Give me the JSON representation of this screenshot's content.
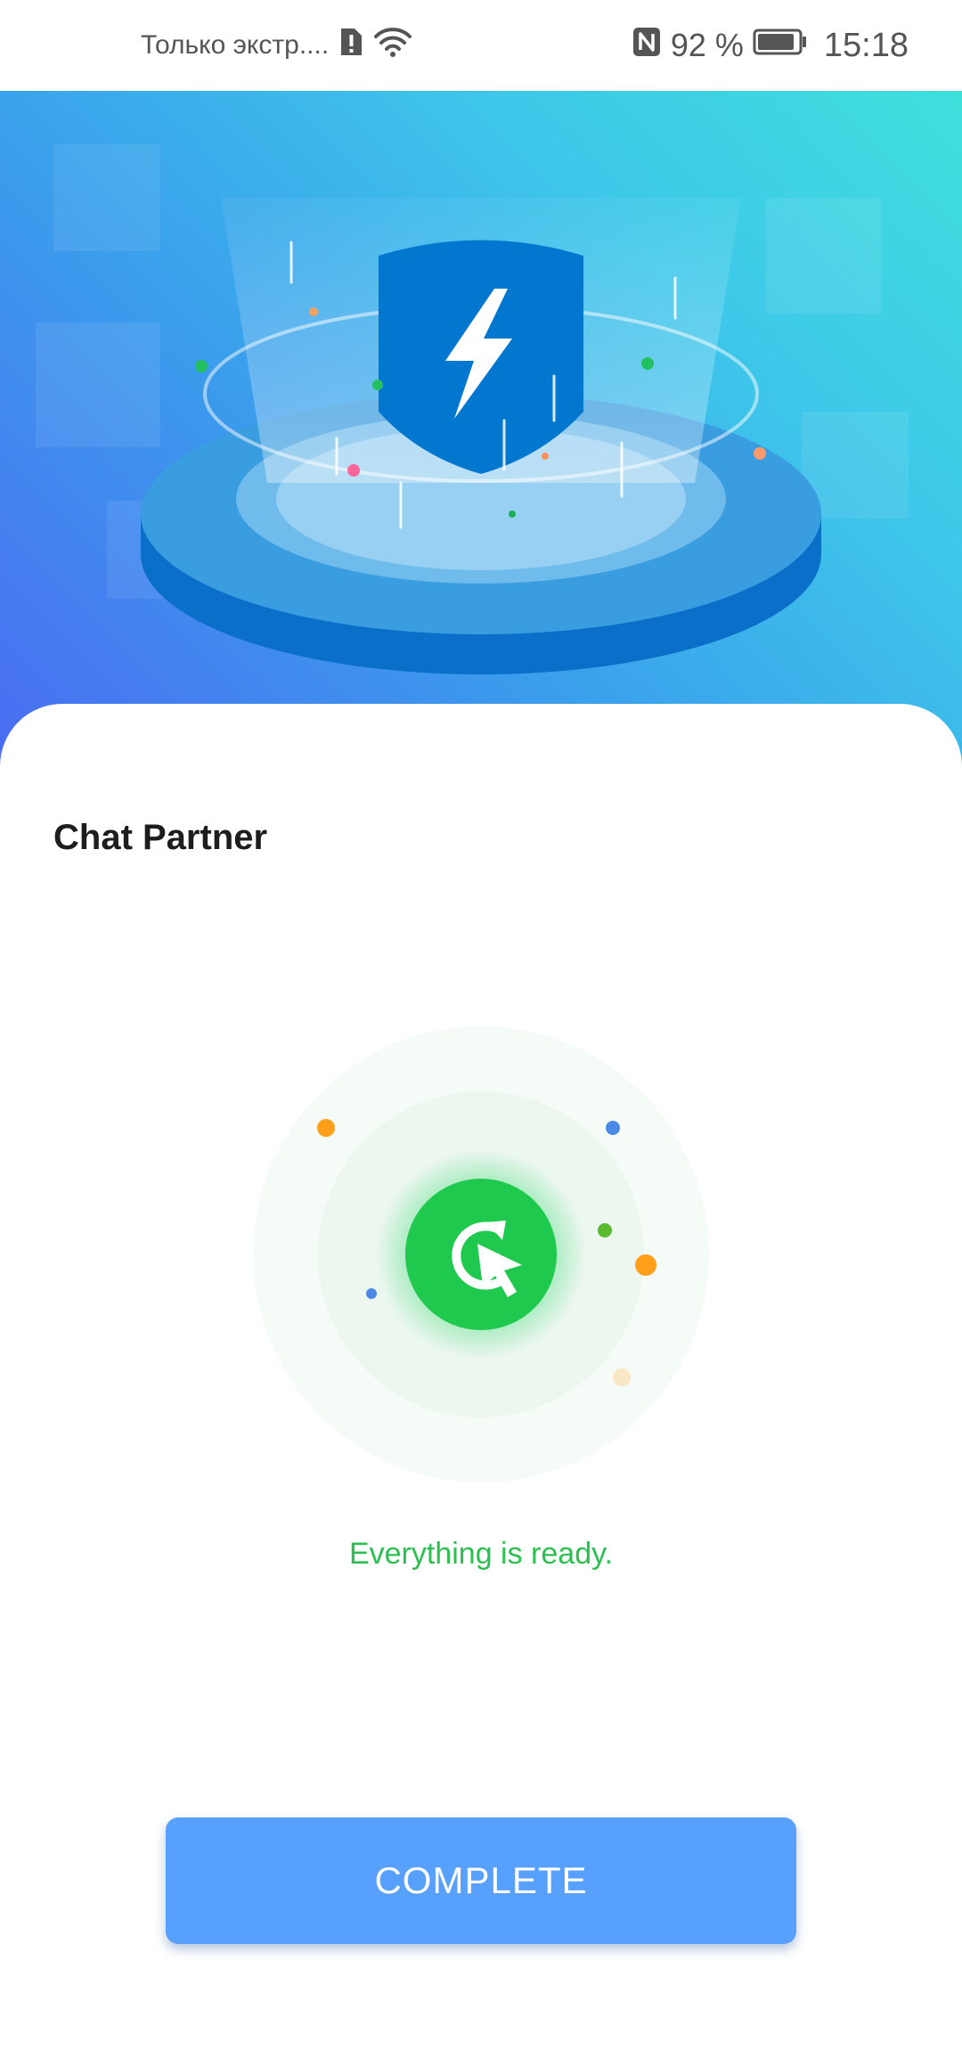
{
  "status_bar": {
    "network_label": "Только экстр....",
    "battery_percent": "92 %",
    "battery_level": 0.92,
    "time": "15:18",
    "icons": [
      "sim-alert-icon",
      "wifi-icon",
      "nfc-icon",
      "battery-icon"
    ]
  },
  "hero": {
    "icon": "shield-lightning-icon",
    "colors": {
      "gradient_start": "#4a6cf2",
      "gradient_end": "#3fe0dc",
      "shield": "#0277d0"
    }
  },
  "card": {
    "app_title": "Chat Partner",
    "status_icon": "refresh-cursor-icon",
    "status_text": "Everything is ready.",
    "complete_button_label": "COMPLETE",
    "colors": {
      "success": "#2cbf52",
      "button": "#57a0fb"
    }
  }
}
